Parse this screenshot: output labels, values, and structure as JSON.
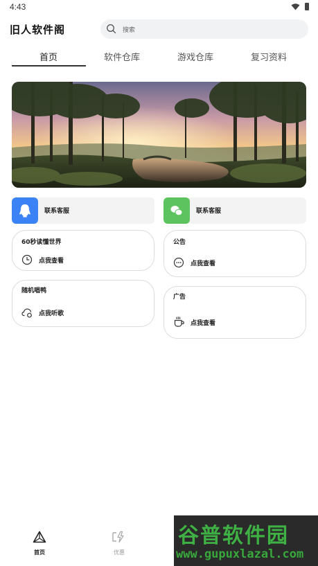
{
  "status": {
    "time": "4:43"
  },
  "app": {
    "title": "旧人软件阁"
  },
  "search": {
    "placeholder": "搜索"
  },
  "tabs": [
    {
      "label": "首页",
      "active": true
    },
    {
      "label": "软件仓库",
      "active": false
    },
    {
      "label": "游戏仓库",
      "active": false
    },
    {
      "label": "复习资料",
      "active": false
    }
  ],
  "contacts": [
    {
      "label": "联系客服",
      "icon": "qq-icon",
      "color": "#3b82f6"
    },
    {
      "label": "联系客服",
      "icon": "wechat-icon",
      "color": "#5cc35f"
    }
  ],
  "cards": {
    "news": {
      "title": "60秒读懂世界",
      "action": "点我查看",
      "icon": "clock-icon"
    },
    "notice": {
      "title": "公告",
      "action": "点我查看",
      "icon": "chat-bubble-icon"
    },
    "music": {
      "title": "随机唱鸭",
      "action": "点我听歌",
      "icon": "cloud-music-icon"
    },
    "ads": {
      "title": "广告",
      "action": "点我查看",
      "icon": "coffee-cup-icon"
    }
  },
  "bottom_nav": [
    {
      "label": "首页",
      "icon": "triangle-home-icon",
      "active": true
    },
    {
      "label": "优惠",
      "icon": "lightning-icon",
      "active": false
    }
  ],
  "watermark": {
    "title": "谷普软件园",
    "url": "www.gupuxlazal.com"
  }
}
